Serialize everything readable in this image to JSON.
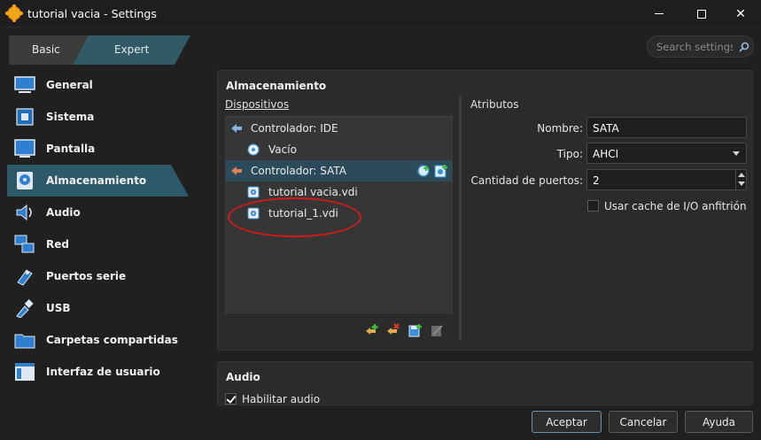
{
  "window": {
    "title": "tutorial vacia - Settings"
  },
  "mode_tabs": {
    "basic": "Basic",
    "expert": "Expert"
  },
  "search": {
    "placeholder": "Search settings"
  },
  "sidebar": {
    "items": [
      {
        "label": "General",
        "icon": "monitor-icon"
      },
      {
        "label": "Sistema",
        "icon": "chip-icon"
      },
      {
        "label": "Pantalla",
        "icon": "display-icon"
      },
      {
        "label": "Almacenamiento",
        "icon": "disk-icon",
        "selected": true
      },
      {
        "label": "Audio",
        "icon": "speaker-icon"
      },
      {
        "label": "Red",
        "icon": "network-icon"
      },
      {
        "label": "Puertos serie",
        "icon": "serial-port-icon"
      },
      {
        "label": "USB",
        "icon": "usb-icon"
      },
      {
        "label": "Carpetas compartidas",
        "icon": "folder-icon"
      },
      {
        "label": "Interfaz de usuario",
        "icon": "window-icon"
      }
    ]
  },
  "storage": {
    "title": "Almacenamiento",
    "devices_label": "Dispositivos",
    "attributes_label": "Atributos",
    "tree": [
      {
        "text": "Controlador: IDE",
        "level": 0,
        "icon": "ide-controller-icon"
      },
      {
        "text": "Vacío",
        "level": 1,
        "icon": "optical-disc-icon"
      },
      {
        "text": "Controlador: SATA",
        "level": 0,
        "icon": "sata-controller-icon",
        "selected": true
      },
      {
        "text": "tutorial vacia.vdi",
        "level": 1,
        "icon": "hard-disk-icon"
      },
      {
        "text": "tutorial_1.vdi",
        "level": 1,
        "icon": "hard-disk-icon"
      }
    ],
    "attributes": {
      "name_label": "Nombre:",
      "name_value": "SATA",
      "type_label": "Tipo:",
      "type_value": "AHCI",
      "ports_label": "Cantidad de puertos:",
      "ports_value": "2",
      "cache_label": "Usar cache de I/O anfitrión",
      "cache_checked": false
    }
  },
  "audio": {
    "title": "Audio",
    "enable_label": "Habilitar audio",
    "enable_checked": true
  },
  "buttons": {
    "ok": "Aceptar",
    "cancel": "Cancelar",
    "help": "Ayuda"
  },
  "colors": {
    "accent": "#2c4b5a",
    "sidebar_selection": "#2d5968",
    "annotation": "#d01b1b"
  }
}
